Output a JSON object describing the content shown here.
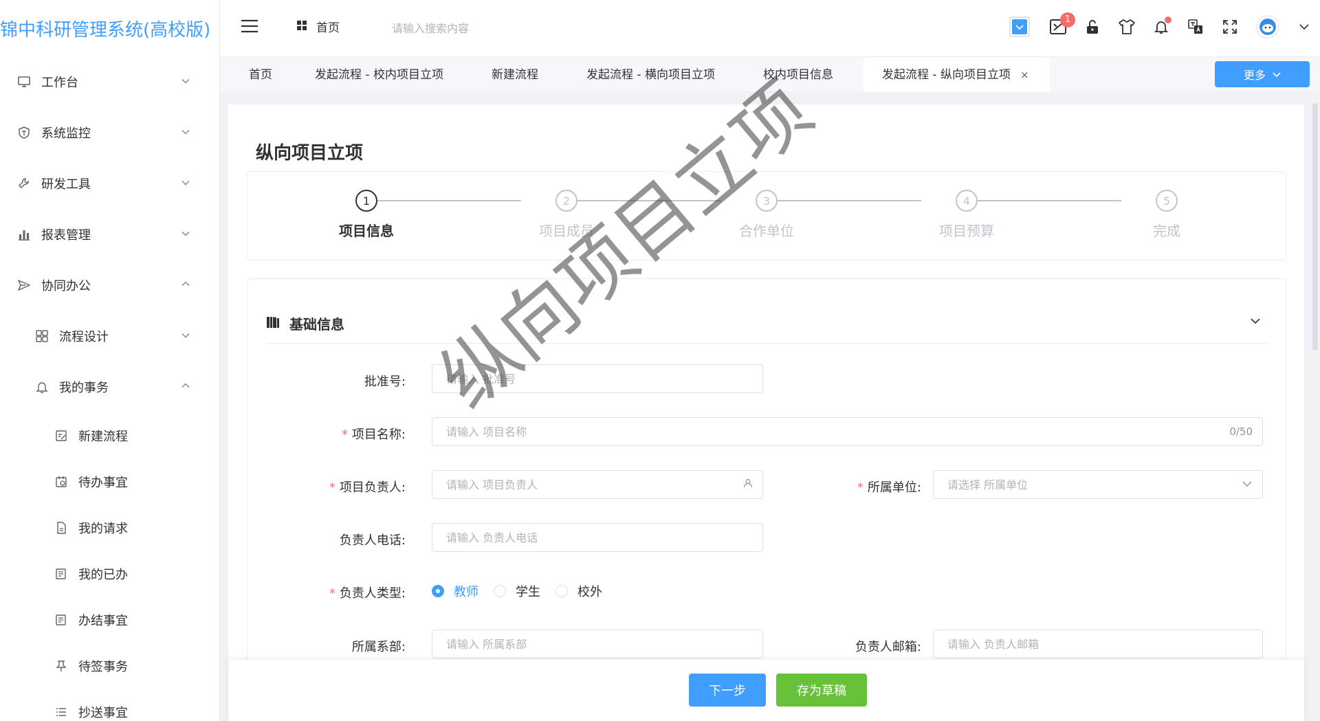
{
  "app": {
    "title": "锦中科研管理系统(高校版)"
  },
  "sidebar": {
    "items": [
      {
        "label": "工作台",
        "icon": "monitor-icon"
      },
      {
        "label": "系统监控",
        "icon": "shield-icon"
      },
      {
        "label": "研发工具",
        "icon": "wrench-icon"
      },
      {
        "label": "报表管理",
        "icon": "bar-chart-icon"
      },
      {
        "label": "协同办公",
        "icon": "send-icon"
      },
      {
        "label": "流程设计",
        "icon": "grid-icon"
      },
      {
        "label": "我的事务",
        "icon": "bell-icon"
      },
      {
        "label": "新建流程",
        "icon": "edit-icon"
      },
      {
        "label": "待办事宜",
        "icon": "calendar-icon"
      },
      {
        "label": "我的请求",
        "icon": "file-icon"
      },
      {
        "label": "我的已办",
        "icon": "list-file-icon"
      },
      {
        "label": "办结事宜",
        "icon": "list-file-icon"
      },
      {
        "label": "待签事务",
        "icon": "pin-icon"
      },
      {
        "label": "抄送事宜",
        "icon": "list-icon"
      }
    ]
  },
  "header": {
    "breadcrumb": "首页",
    "search_placeholder": "请输入搜索内容",
    "notification_count": "1"
  },
  "tabs": {
    "items": [
      {
        "label": "首页"
      },
      {
        "label": "发起流程 - 校内项目立项"
      },
      {
        "label": "新建流程"
      },
      {
        "label": "发起流程 - 横向项目立项"
      },
      {
        "label": "校内项目信息"
      },
      {
        "label": "发起流程 - 纵向项目立项"
      }
    ],
    "close_symbol": "×",
    "more_label": "更多"
  },
  "page": {
    "title": "纵向项目立项",
    "watermark": "纵向项目立项"
  },
  "steps": [
    {
      "num": "1",
      "label": "项目信息"
    },
    {
      "num": "2",
      "label": "项目成员"
    },
    {
      "num": "3",
      "label": "合作单位"
    },
    {
      "num": "4",
      "label": "项目预算"
    },
    {
      "num": "5",
      "label": "完成"
    }
  ],
  "form": {
    "section_title": "基础信息",
    "approval_no": {
      "label": "批准号:",
      "placeholder": "请输入 批准号"
    },
    "project_name": {
      "label": "项目名称:",
      "placeholder": "请输入 项目名称",
      "counter": "0/50"
    },
    "leader": {
      "label": "项目负责人:",
      "placeholder": "请输入 项目负责人"
    },
    "unit": {
      "label": "所属单位:",
      "placeholder": "请选择 所属单位"
    },
    "leader_phone": {
      "label": "负责人电话:",
      "placeholder": "请输入 负责人电话"
    },
    "leader_type": {
      "label": "负责人类型:",
      "options": [
        "教师",
        "学生",
        "校外"
      ],
      "selected": "教师"
    },
    "department": {
      "label": "所属系部:",
      "placeholder": "请输入 所属系部"
    },
    "leader_email": {
      "label": "负责人邮箱:",
      "placeholder": "请输入 负责人邮箱"
    }
  },
  "footer": {
    "next_label": "下一步",
    "draft_label": "存为草稿"
  },
  "colors": {
    "primary": "#409eff",
    "success": "#67c23a",
    "danger": "#f56c6c"
  }
}
